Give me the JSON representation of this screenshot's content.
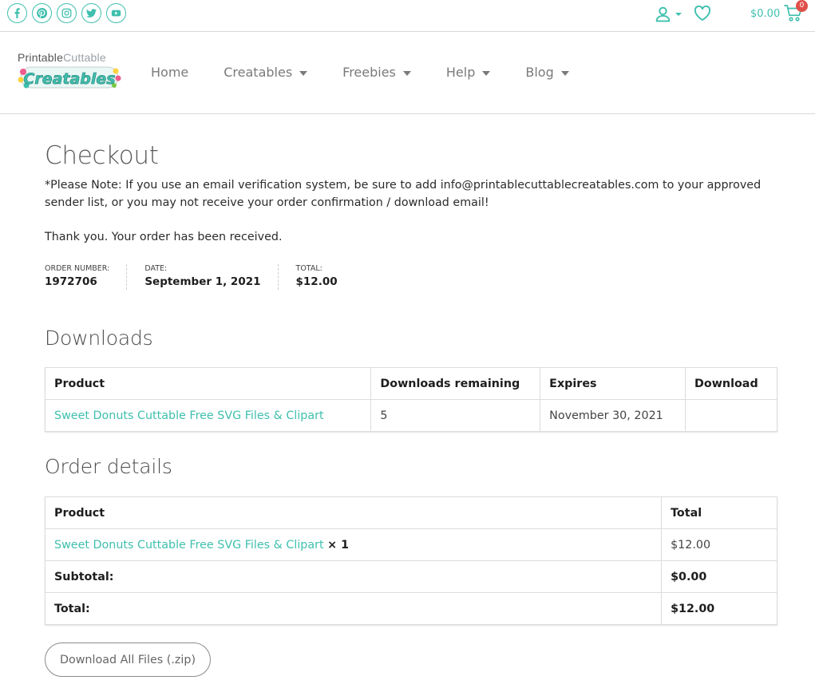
{
  "topbar": {
    "social": [
      {
        "name": "facebook-icon"
      },
      {
        "name": "pinterest-icon"
      },
      {
        "name": "instagram-icon"
      },
      {
        "name": "twitter-icon"
      },
      {
        "name": "youtube-icon"
      }
    ],
    "cart_total": "$0.00",
    "cart_count": "0",
    "accent_color": "#3fbfae",
    "badge_color": "#e0504a"
  },
  "header": {
    "logo_word1": "Printable",
    "logo_word2": "Cuttable",
    "logo_word3": "Creatables",
    "nav": [
      {
        "label": "Home",
        "has_dropdown": false
      },
      {
        "label": "Creatables",
        "has_dropdown": true
      },
      {
        "label": "Freebies",
        "has_dropdown": true
      },
      {
        "label": "Help",
        "has_dropdown": true
      },
      {
        "label": "Blog",
        "has_dropdown": true
      }
    ]
  },
  "page": {
    "title": "Checkout",
    "note": "*Please Note: If you use an email verification system, be sure to add info@printablecuttablecreatables.com to your approved sender list, or you may not receive your order confirmation / download email!",
    "thanks": "Thank you. Your order has been received.",
    "overview": {
      "order_number_label": "Order number:",
      "order_number": "1972706",
      "date_label": "Date:",
      "date": "September 1, 2021",
      "total_label": "Total:",
      "total": "$12.00"
    }
  },
  "downloads": {
    "title": "Downloads",
    "headers": [
      "Product",
      "Downloads remaining",
      "Expires",
      "Download"
    ],
    "rows": [
      {
        "product": "Sweet Donuts Cuttable Free SVG Files & Clipart",
        "remaining": "5",
        "expires": "November 30, 2021",
        "download": ""
      }
    ]
  },
  "order_details": {
    "title": "Order details",
    "headers": [
      "Product",
      "Total"
    ],
    "item": {
      "product": "Sweet Donuts Cuttable Free SVG Files & Clipart",
      "qty": "× 1",
      "total": "$12.00"
    },
    "subtotal_label": "Subtotal:",
    "subtotal": "$0.00",
    "total_label": "Total:",
    "total": "$12.00"
  },
  "download_all_label": "Download All Files (.zip)"
}
